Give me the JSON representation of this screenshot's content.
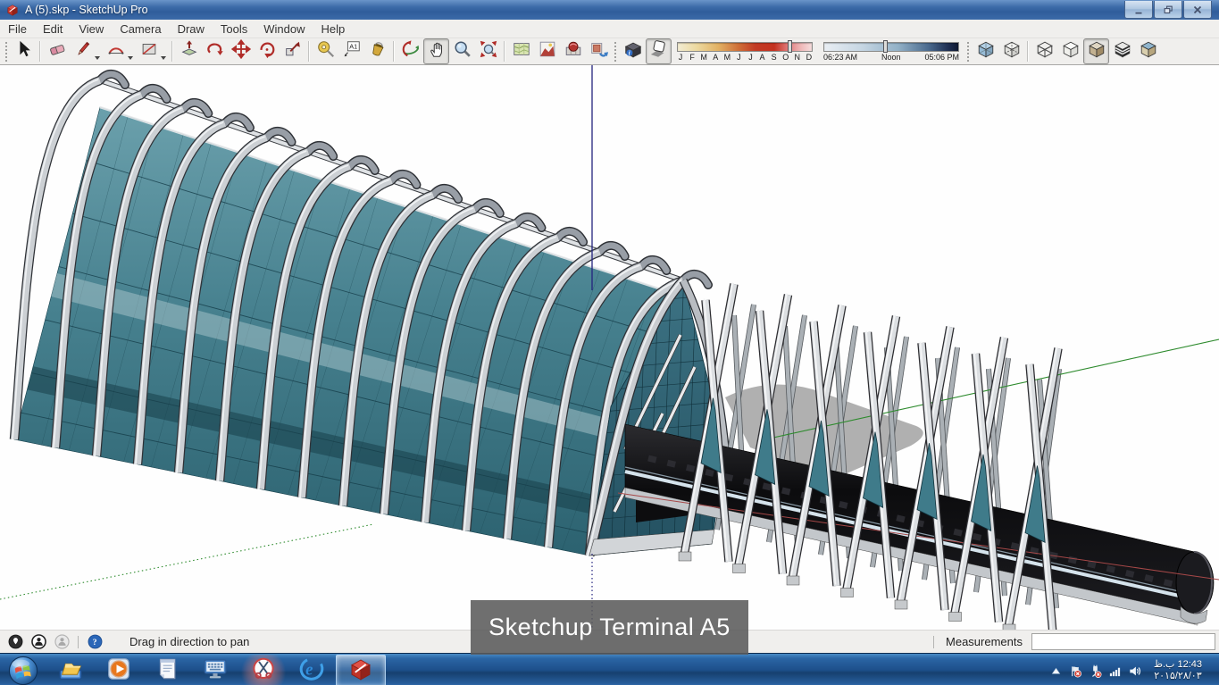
{
  "window": {
    "title": "A (5).skp - SketchUp Pro",
    "controls": [
      {
        "name": "minimize"
      },
      {
        "name": "restore"
      },
      {
        "name": "close"
      }
    ]
  },
  "menu": {
    "items": [
      "File",
      "Edit",
      "View",
      "Camera",
      "Draw",
      "Tools",
      "Window",
      "Help"
    ]
  },
  "toolbar": {
    "groups": [
      {
        "name": "principal",
        "tools": [
          {
            "icon": "select",
            "name": "select"
          }
        ]
      },
      {
        "name": "drawing",
        "tools": [
          {
            "icon": "eraser",
            "name": "eraser"
          },
          {
            "icon": "line",
            "name": "line",
            "dropdown": true
          },
          {
            "icon": "arc",
            "name": "arc",
            "dropdown": true
          },
          {
            "icon": "rectangle",
            "name": "rectangle",
            "dropdown": true
          }
        ]
      },
      {
        "name": "modification",
        "tools": [
          {
            "icon": "pushpull",
            "name": "push-pull"
          },
          {
            "icon": "followme",
            "name": "follow-me"
          },
          {
            "icon": "move",
            "name": "move"
          },
          {
            "icon": "rotate",
            "name": "rotate"
          },
          {
            "icon": "scale",
            "name": "scale"
          }
        ]
      },
      {
        "name": "construction",
        "tools": [
          {
            "icon": "tape",
            "name": "tape-measure"
          },
          {
            "icon": "text",
            "name": "text"
          },
          {
            "icon": "paint",
            "name": "paint-bucket"
          }
        ]
      },
      {
        "name": "camera",
        "tools": [
          {
            "icon": "orbit",
            "name": "orbit"
          },
          {
            "icon": "pan",
            "name": "pan",
            "active": true
          },
          {
            "icon": "zoom",
            "name": "zoom"
          },
          {
            "icon": "zoom-extents",
            "name": "zoom-extents"
          }
        ]
      },
      {
        "name": "location",
        "tools": [
          {
            "icon": "add-location",
            "name": "add-location"
          },
          {
            "icon": "toggle-terrain",
            "name": "toggle-terrain"
          },
          {
            "icon": "photo-textures",
            "name": "photo-textures"
          },
          {
            "icon": "share-model",
            "name": "share-model"
          }
        ]
      }
    ],
    "shadows": {
      "settings_name": "shadow-settings",
      "toggle_name": "shadow-toggle",
      "toggle_active": true,
      "months": [
        "J",
        "F",
        "M",
        "A",
        "M",
        "J",
        "J",
        "A",
        "S",
        "O",
        "N",
        "D"
      ],
      "date_percent": 82,
      "time_start": "06:23 AM",
      "time_mid": "Noon",
      "time_end": "05:06 PM",
      "time_percent": 44
    },
    "face_styles": [
      {
        "tools": [
          {
            "icon": "xray",
            "name": "x-ray"
          },
          {
            "icon": "back-edges",
            "name": "back-edges"
          }
        ]
      },
      {
        "tools": [
          {
            "icon": "wireframe",
            "name": "wireframe"
          },
          {
            "icon": "hidden-line",
            "name": "hidden-line"
          },
          {
            "icon": "shaded",
            "name": "shaded",
            "active": true
          },
          {
            "icon": "shaded-textures",
            "name": "shaded-with-textures"
          },
          {
            "icon": "monochrome",
            "name": "monochrome"
          }
        ]
      }
    ]
  },
  "viewport": {
    "caption": "Sketchup Terminal A5"
  },
  "status_bar": {
    "icons": [
      {
        "icon": "geolocation",
        "name": "geolocation"
      },
      {
        "icon": "credits",
        "name": "credits"
      },
      {
        "icon": "user",
        "name": "sign-in"
      }
    ],
    "help_icon": "help",
    "hint": "Drag in direction to pan",
    "measurements_label": "Measurements",
    "measurements_value": ""
  },
  "taskbar": {
    "apps": [
      {
        "icon": "explorer",
        "name": "windows-explorer"
      },
      {
        "icon": "media-player",
        "name": "media-player"
      },
      {
        "icon": "notepad",
        "name": "notepad"
      },
      {
        "icon": "osk",
        "name": "on-screen-keyboard"
      },
      {
        "icon": "snipping",
        "name": "snipping-tool",
        "glow": true
      },
      {
        "icon": "ie",
        "name": "internet-explorer"
      },
      {
        "icon": "sketchup",
        "name": "sketchup",
        "active": true
      }
    ],
    "tray_icons": [
      {
        "icon": "expand",
        "name": "show-hidden-icons"
      },
      {
        "icon": "flag-alert",
        "name": "action-center"
      },
      {
        "icon": "power-alert",
        "name": "power-status"
      },
      {
        "icon": "network",
        "name": "network-status"
      },
      {
        "icon": "volume",
        "name": "volume"
      }
    ],
    "clock_time": "12:43 ب.ظ",
    "clock_date": "۲۰۱۵/۲۸/۰۳"
  },
  "colors": {
    "glass_teal": "#3f7d8c",
    "frame_gray": "#c9ccd0",
    "axis_blue": "#23237e",
    "axis_green": "#2e8b2e",
    "axis_red": "#a64848",
    "caption_bg": "#5a5a5a"
  }
}
